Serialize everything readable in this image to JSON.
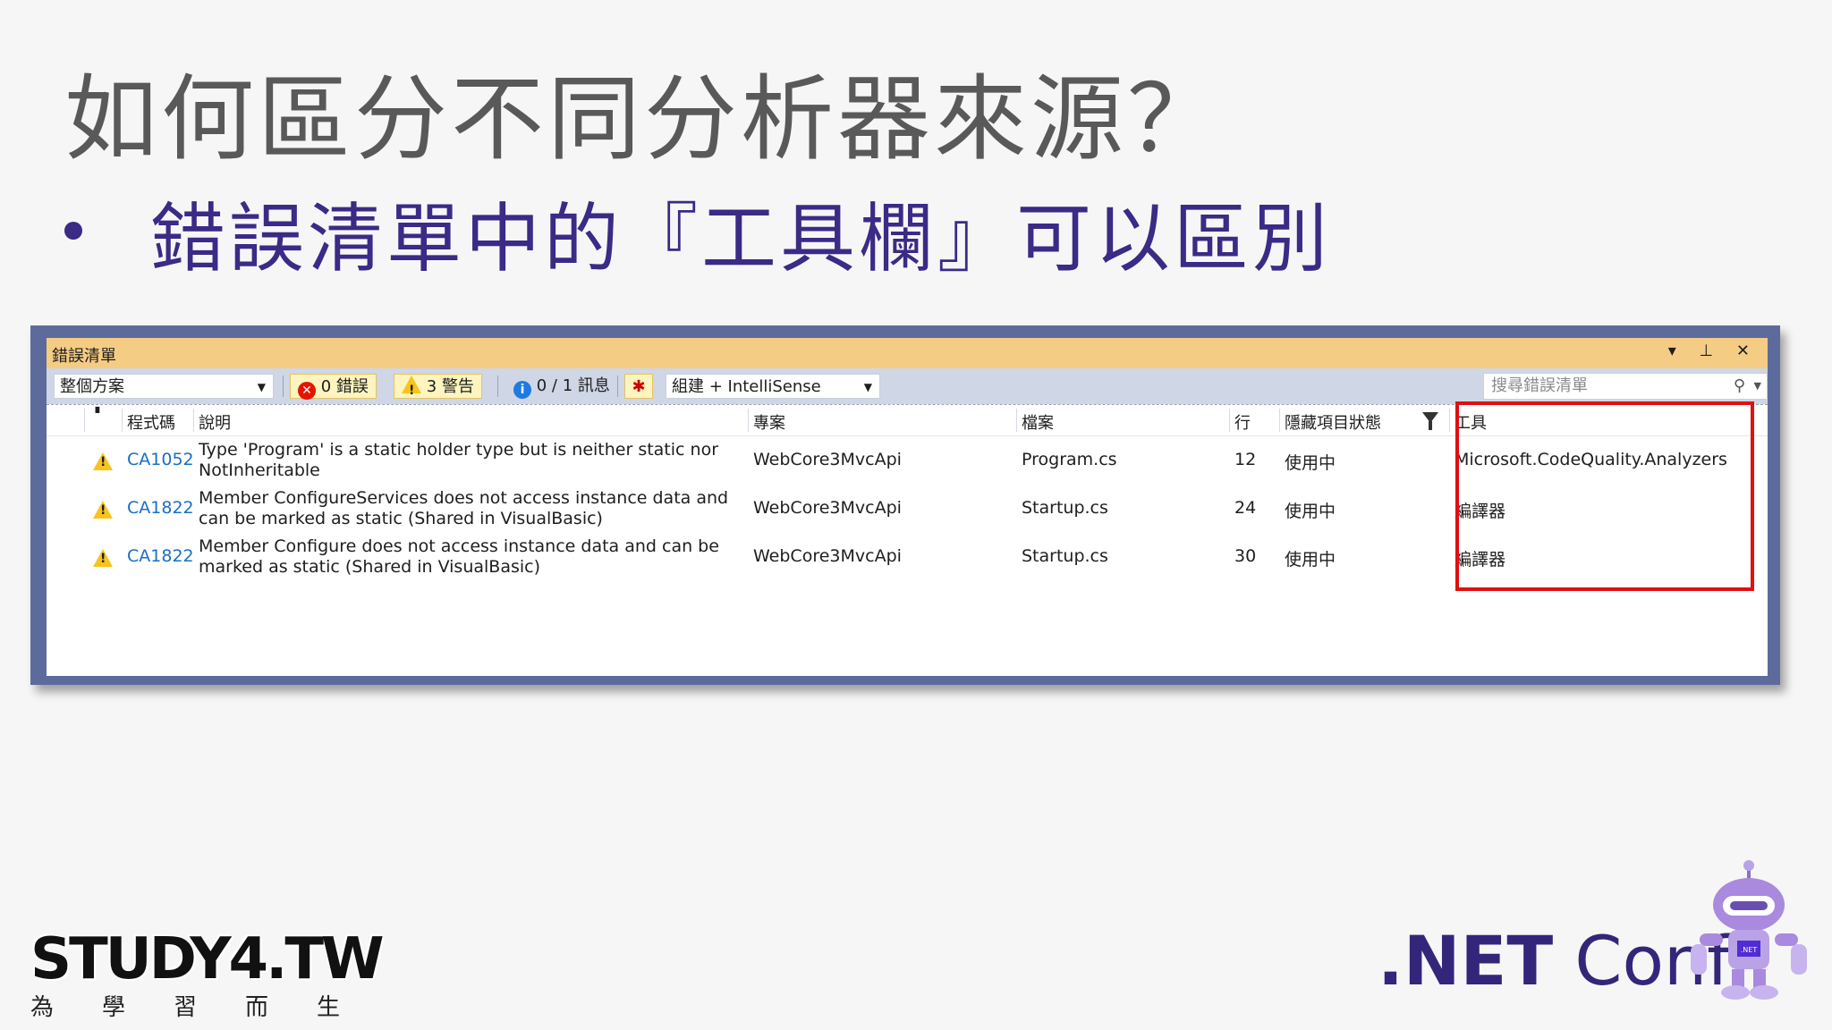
{
  "slide": {
    "title": "如何區分不同分析器來源？",
    "bullet": "錯誤清單中的『工具欄』可以區別"
  },
  "error_list": {
    "window_title": "錯誤清單",
    "title_controls": "▾ ⊥ ✕",
    "toolbar": {
      "scope_combo": "整個方案",
      "errors_button": "0 錯誤",
      "warnings_button": "3 警告",
      "messages_button": "0 / 1 訊息",
      "build_combo": "組建 + IntelliSense",
      "search_placeholder": "搜尋錯誤清單"
    },
    "columns": {
      "code": "程式碼",
      "description": "說明",
      "project": "專案",
      "file": "檔案",
      "line": "行",
      "suppression": "隱藏項目狀態",
      "tool": "工具"
    },
    "rows": [
      {
        "code": "CA1052",
        "description": "Type 'Program' is a static holder type but is neither static nor NotInheritable",
        "project": "WebCore3MvcApi",
        "file": "Program.cs",
        "line": "12",
        "suppression": "使用中",
        "tool": "Microsoft.CodeQuality.Analyzers"
      },
      {
        "code": "CA1822",
        "description": "Member ConfigureServices does not access instance data and can be marked as static (Shared in VisualBasic)",
        "project": "WebCore3MvcApi",
        "file": "Startup.cs",
        "line": "24",
        "suppression": "使用中",
        "tool": "編譯器"
      },
      {
        "code": "CA1822",
        "description": "Member Configure does not access instance data and can be marked as static (Shared in VisualBasic)",
        "project": "WebCore3MvcApi",
        "file": "Startup.cs",
        "line": "30",
        "suppression": "使用中",
        "tool": "編譯器"
      }
    ]
  },
  "logos": {
    "study4": "STUDY4.TW",
    "study4_sub": [
      "為",
      "學",
      "習",
      "而",
      "生"
    ],
    "netconf_prefix": ".NET",
    "netconf_suffix": " Conf",
    "mascot_badge": ".NET"
  },
  "colors": {
    "title_text": "#595959",
    "bullet_text": "#3b2a86",
    "window_title_bar": "#f5cc84",
    "toolbar_bg": "#cfd6e5",
    "code_link": "#1a6fc5",
    "highlight_border": "#e01010",
    "netconf_purple": "#33267a"
  }
}
